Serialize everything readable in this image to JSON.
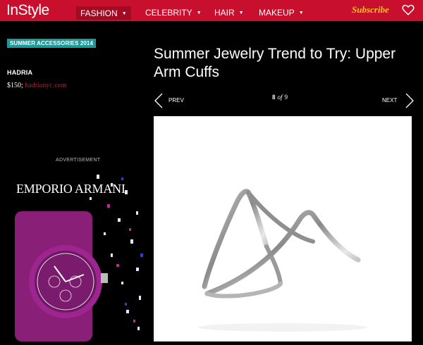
{
  "header": {
    "logo": "InStyle",
    "nav": [
      {
        "label": "FASHION"
      },
      {
        "label": "CELEBRITY"
      },
      {
        "label": "HAIR"
      },
      {
        "label": "MAKEUP"
      }
    ],
    "subscribe": "Subscribe",
    "heart_icon": "heart-icon"
  },
  "sidebar": {
    "tag": "SUMMER ACCESSORIES 2014",
    "brand": "HADRIA",
    "price": "$150;",
    "link": "hadrianyc.com",
    "ad_label": "ADVERTISEMENT",
    "ad_logo": "EMPORIO ARMANI"
  },
  "article": {
    "title": "Summer Jewelry Trend to Try: Upper Arm Cuffs",
    "prev": "PREV",
    "next": "NEXT",
    "current": "8",
    "of": "of",
    "total": "9"
  },
  "colors": {
    "brand_red": "#c8102e",
    "tag_teal": "#1a9a99",
    "subscribe_gold": "#f5c518"
  }
}
